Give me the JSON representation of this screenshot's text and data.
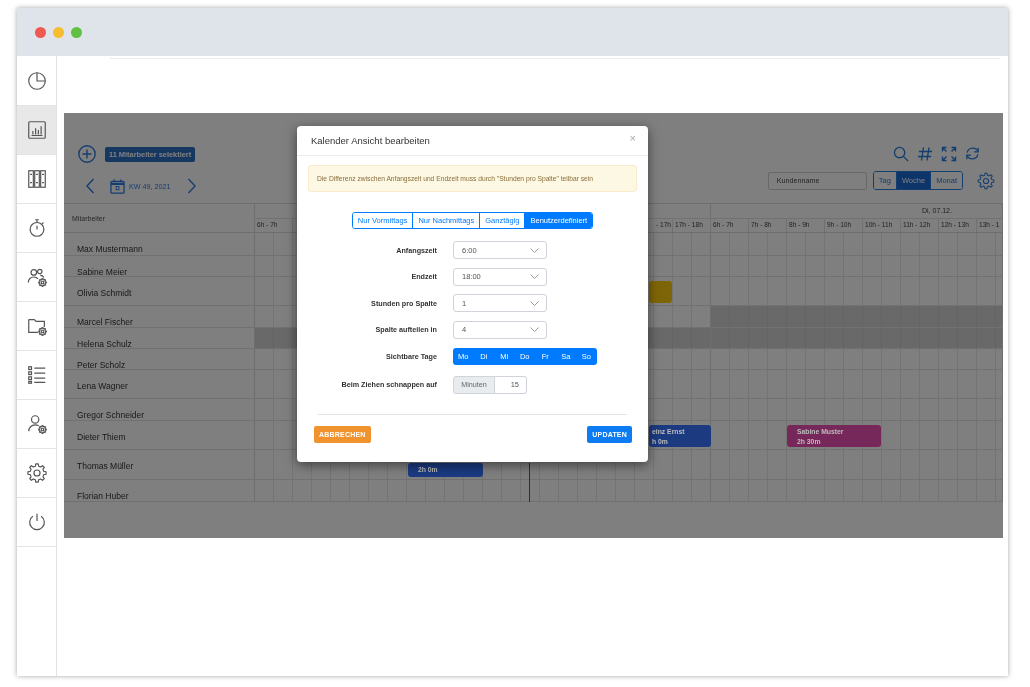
{
  "sidebar": {
    "items": [
      {
        "selected": false
      },
      {
        "selected": true
      },
      {
        "selected": false
      },
      {
        "selected": false
      },
      {
        "selected": false
      },
      {
        "selected": false
      },
      {
        "selected": false
      },
      {
        "selected": false
      },
      {
        "selected": false
      },
      {
        "selected": false
      }
    ]
  },
  "toolbar": {
    "selection_badge": "11 Mitarbeiter selektiert",
    "week": "KW 49, 2021",
    "customer_search": {
      "placeholder": "Kundenname"
    },
    "views": [
      {
        "label": "Tag",
        "selected": false
      },
      {
        "label": "Woche",
        "selected": true
      },
      {
        "label": "Monat",
        "selected": false
      }
    ]
  },
  "calendar": {
    "employee_header": "Mitarbeiter",
    "days": [
      {
        "hours": [
          "6h - 7h",
          "- 17h",
          "17h - 18h"
        ]
      },
      {
        "date": "Di, 07.12.",
        "hours": [
          "6h - 7h",
          "7h - 8h",
          "8h - 9h",
          "9h - 10h",
          "10h - 11h",
          "11h - 12h",
          "12h - 13h",
          "13h - 1"
        ]
      }
    ],
    "employees": [
      {
        "name": "Max Mustermann",
        "days": [
          {
            "absent": false
          },
          {
            "absent": false
          }
        ]
      },
      {
        "name": "Sabine Meier",
        "days": [
          {
            "absent": false
          },
          {
            "absent": false
          }
        ]
      },
      {
        "name": "Olivia Schmidt",
        "days": [
          {
            "absent": false
          },
          {
            "absent": false
          }
        ],
        "events": [
          {
            "color": "#7e6608"
          }
        ]
      },
      {
        "name": "Marcel Fischer",
        "days": [
          {
            "absent": false
          },
          {
            "absent": true
          }
        ]
      },
      {
        "name": "Helena Schulz",
        "days": [
          {
            "absent": true
          },
          {
            "absent": true
          }
        ]
      },
      {
        "name": "Peter Scholz",
        "days": [
          {
            "absent": false
          },
          {
            "absent": false
          }
        ]
      },
      {
        "name": "Lena Wagner",
        "days": [
          {
            "absent": false
          },
          {
            "absent": false
          }
        ]
      },
      {
        "name": "Gregor Schneider",
        "days": [
          {
            "absent": false
          },
          {
            "absent": false
          }
        ]
      },
      {
        "name": "Dieter Thiem",
        "days": [
          {
            "absent": false
          },
          {
            "absent": false
          }
        ],
        "events": [
          {
            "title": "einz Ernst",
            "duration": "h 0m",
            "color": "#1b3a80"
          },
          {
            "title": "Sabine Muster",
            "duration": "2h 30m",
            "color": "#76285a"
          }
        ]
      },
      {
        "name": "Thomas Müller",
        "days": [
          {
            "absent": false
          },
          {
            "absent": false
          }
        ],
        "events": [
          {
            "duration": "2h 0m",
            "color": "#1b3a80"
          }
        ]
      },
      {
        "name": "Florian Huber",
        "days": [
          {
            "absent": false
          },
          {
            "absent": false
          }
        ]
      }
    ]
  },
  "dialog": {
    "title": "Kalender Ansicht bearbeiten",
    "close": "×",
    "alert": "Die Differenz zwischen Anfangszeit und Endzeit muss durch \"Stunden pro Spalte\" teilbar sein",
    "presets": [
      {
        "label": "Nur Vormittags",
        "selected": false
      },
      {
        "label": "Nur Nachmittags",
        "selected": false
      },
      {
        "label": "Ganztägig",
        "selected": false
      },
      {
        "label": "Benutzerdefiniert",
        "selected": true
      }
    ],
    "fields": [
      {
        "kind": "select",
        "label": "Anfangszeit",
        "value": "6:00"
      },
      {
        "kind": "select",
        "label": "Endzeit",
        "value": "18:00"
      },
      {
        "kind": "select",
        "label": "Stunden pro Spalte",
        "value": "1"
      },
      {
        "kind": "select",
        "label": "Spalte aufteilen in",
        "value": "4"
      },
      {
        "kind": "days",
        "label": "Sichtbare Tage",
        "days": [
          {
            "label": "Mo",
            "selected": true
          },
          {
            "label": "Di",
            "selected": true
          },
          {
            "label": "Mi",
            "selected": true
          },
          {
            "label": "Do",
            "selected": true
          },
          {
            "label": "Fr",
            "selected": true
          },
          {
            "label": "Sa",
            "selected": true
          },
          {
            "label": "So",
            "selected": true
          }
        ]
      },
      {
        "kind": "addon",
        "label": "Beim Ziehen schnappen auf",
        "addon": "Minuten",
        "value": "15"
      }
    ],
    "buttons": [
      {
        "kind": "cancel",
        "label": "ABBRECHEN"
      },
      {
        "kind": "primary",
        "label": "UPDATEN"
      }
    ]
  }
}
